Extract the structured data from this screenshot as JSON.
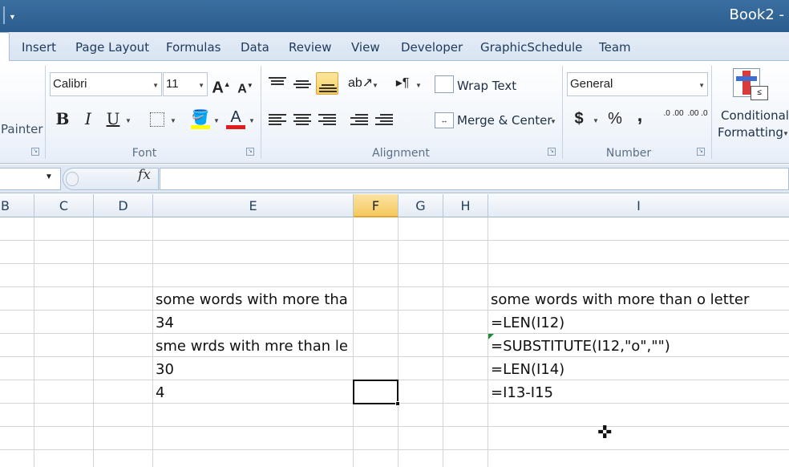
{
  "title": "Book2 -",
  "tabs": [
    "Insert",
    "Page Layout",
    "Formulas",
    "Data",
    "Review",
    "View",
    "Developer",
    "GraphicSchedule",
    "Team"
  ],
  "clipboard": {
    "painter_label": "Painter"
  },
  "font": {
    "name": "Calibri",
    "size": "11",
    "grow": "A",
    "shrink": "A",
    "bold": "B",
    "italic": "I",
    "underline": "U",
    "fill_color": "#ffff00",
    "font_color": "#e01b1b",
    "font_color_letter": "A",
    "group_label": "Font"
  },
  "alignment": {
    "wrap_text": "Wrap Text",
    "merge_center": "Merge & Center",
    "group_label": "Alignment"
  },
  "number": {
    "format": "General",
    "currency": "$",
    "percent": "%",
    "comma": ",",
    "inc_decimal": ".0 .00",
    "dec_decimal": ".00 .0",
    "group_label": "Number"
  },
  "styles": {
    "cond_format_line1": "Conditional",
    "cond_format_line2": "Formatting"
  },
  "formula_bar": {
    "fx": "fx",
    "content": ""
  },
  "columns": [
    "B",
    "C",
    "D",
    "E",
    "F",
    "G",
    "H",
    "I"
  ],
  "cells": {
    "e12": "some words with more tha",
    "e13": "34",
    "e14": "sme wrds with mre than  le",
    "e15": "30",
    "e16": "4",
    "i12": "some words with more than o letter",
    "i13": "=LEN(I12)",
    "i14": "=SUBSTITUTE(I12,\"o\",\"\")",
    "i15": "=LEN(I14)",
    "i16": "=I13-I15"
  }
}
